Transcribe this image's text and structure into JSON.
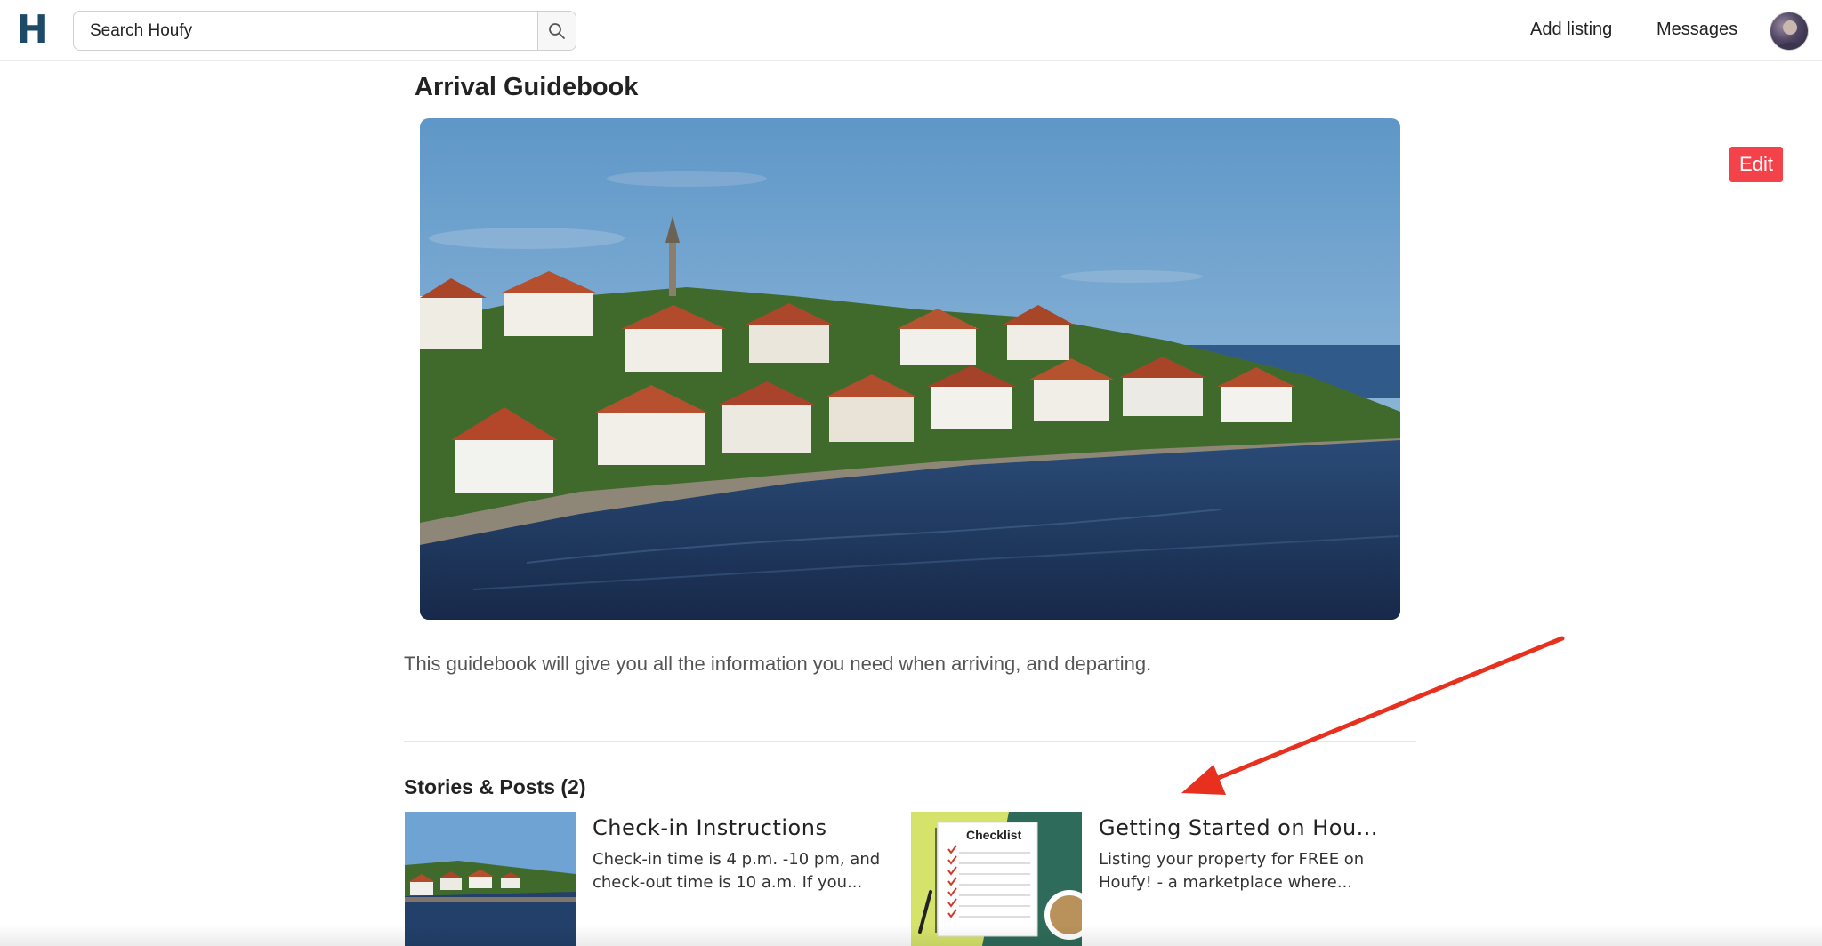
{
  "header": {
    "logo_text": "H",
    "search": {
      "placeholder": "Search Houfy",
      "icon": "search-icon"
    },
    "nav": {
      "add_listing": "Add listing",
      "messages": "Messages"
    },
    "avatar_icon": "user-avatar"
  },
  "guidebook": {
    "title": "Arrival Guidebook",
    "edit_label": "Edit",
    "description": "This guidebook will give you all the information you need when arriving, and departing.",
    "stories_heading": "Stories & Posts (2)"
  },
  "posts": [
    {
      "title": "Check-in Instructions",
      "excerpt": "Check-in time is 4 p.m. -10 pm, and check-out time is 10 a.m. If you..."
    },
    {
      "title": "Getting Started on Hou...",
      "excerpt": "Listing your property for FREE on Houfy! - a marketplace where...",
      "thumb_label": "Checklist"
    }
  ],
  "colors": {
    "brand": "#1d4a66",
    "edit_button": "#f4424b",
    "annotation_arrow": "#e8301f"
  }
}
